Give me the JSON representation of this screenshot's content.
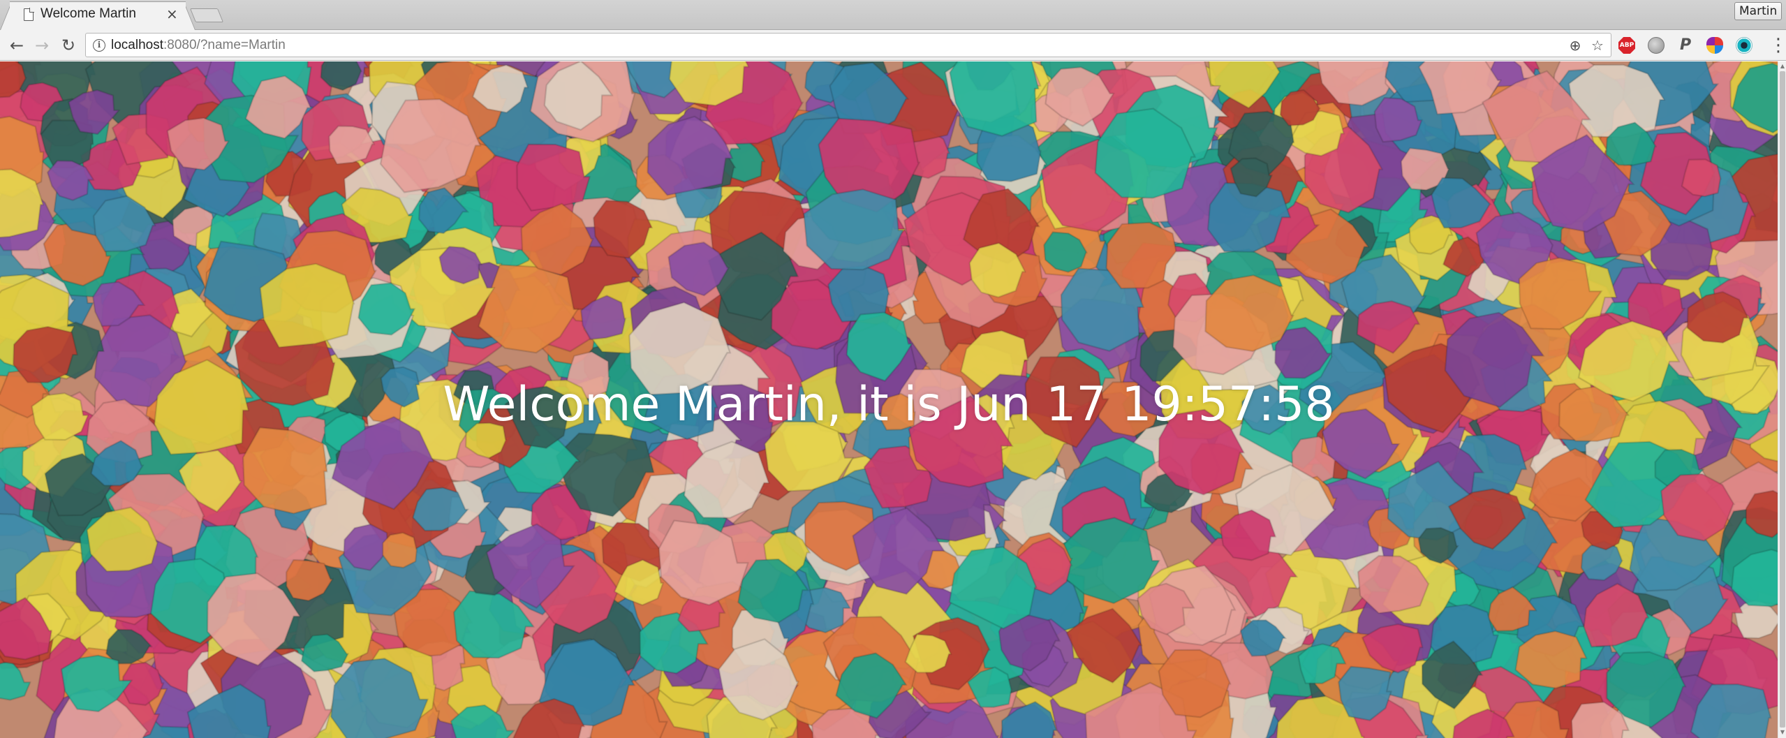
{
  "browser": {
    "tab": {
      "title": "Welcome Martin",
      "close_glyph": "×",
      "icon": "page-icon"
    },
    "profile_name": "Martin",
    "address_bar": {
      "host": "localhost",
      "rest": ":8080/?name=Martin",
      "icon": "info-icon"
    },
    "nav": {
      "back_glyph": "←",
      "forward_glyph": "→",
      "reload_glyph": "↻"
    },
    "omnibox_icons": {
      "zoom_glyph": "⊕",
      "star_glyph": "☆"
    },
    "extensions": [
      {
        "name": "adblock-plus-icon",
        "label": "ABP"
      },
      {
        "name": "globe-extension-icon",
        "label": ""
      },
      {
        "name": "p-extension-icon",
        "label": "P"
      },
      {
        "name": "colorful-extension-icon",
        "label": ""
      },
      {
        "name": "ring-extension-icon",
        "label": ""
      }
    ],
    "menu_glyph": "⋮"
  },
  "page": {
    "greeting": "Welcome Martin, it is Jun 17 19:57:58",
    "background": "confetti-photo"
  },
  "colors": {
    "greeting_text": "#ffffff",
    "tabstrip": "#cccccc",
    "toolbar": "#f2f2f2",
    "abp_red": "#d9232b"
  }
}
